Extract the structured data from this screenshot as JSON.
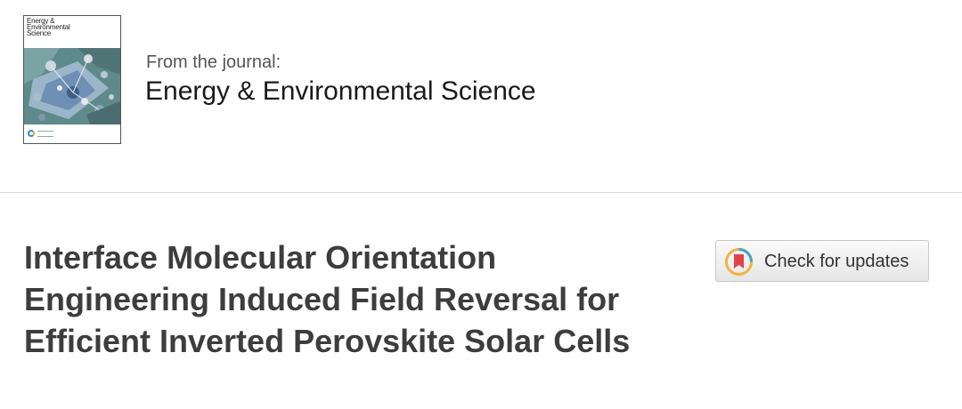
{
  "journal": {
    "cover_title": "Energy & Environmental Science",
    "from_label": "From the journal:",
    "name": "Energy & Environmental Science"
  },
  "article": {
    "title": "Interface Molecular Orientation Engineering Induced Field Reversal for Efficient Inverted Perovskite Solar Cells"
  },
  "check_updates": {
    "label": "Check for updates",
    "icon": "crossmark-bookmark-icon"
  },
  "colors": {
    "title_text": "#3d3d3d",
    "journal_text": "#1a1a1a",
    "label_text": "#555555",
    "divider": "#d9d9d9",
    "crossmark_red": "#e2434b",
    "crossmark_yellow": "#f2b33d",
    "crossmark_teal": "#3da8c4"
  }
}
